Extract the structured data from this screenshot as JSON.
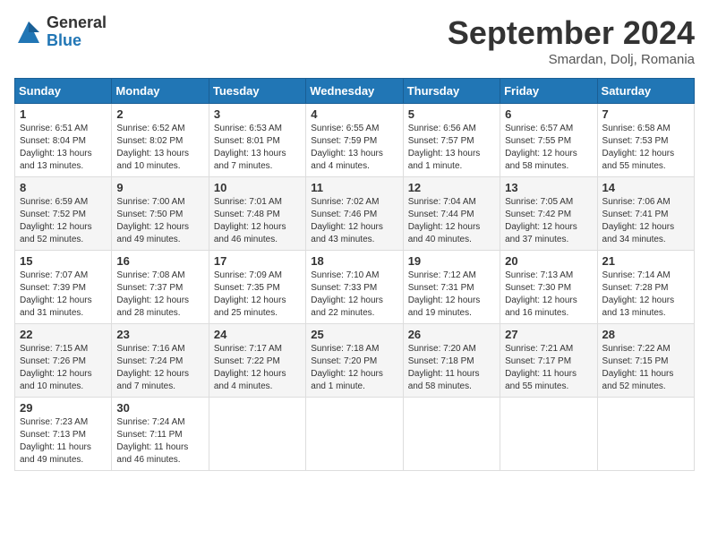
{
  "header": {
    "logo_general": "General",
    "logo_blue": "Blue",
    "month_title": "September 2024",
    "location": "Smardan, Dolj, Romania"
  },
  "weekdays": [
    "Sunday",
    "Monday",
    "Tuesday",
    "Wednesday",
    "Thursday",
    "Friday",
    "Saturday"
  ],
  "weeks": [
    [
      {
        "day": "1",
        "lines": [
          "Sunrise: 6:51 AM",
          "Sunset: 8:04 PM",
          "Daylight: 13 hours",
          "and 13 minutes."
        ]
      },
      {
        "day": "2",
        "lines": [
          "Sunrise: 6:52 AM",
          "Sunset: 8:02 PM",
          "Daylight: 13 hours",
          "and 10 minutes."
        ]
      },
      {
        "day": "3",
        "lines": [
          "Sunrise: 6:53 AM",
          "Sunset: 8:01 PM",
          "Daylight: 13 hours",
          "and 7 minutes."
        ]
      },
      {
        "day": "4",
        "lines": [
          "Sunrise: 6:55 AM",
          "Sunset: 7:59 PM",
          "Daylight: 13 hours",
          "and 4 minutes."
        ]
      },
      {
        "day": "5",
        "lines": [
          "Sunrise: 6:56 AM",
          "Sunset: 7:57 PM",
          "Daylight: 13 hours",
          "and 1 minute."
        ]
      },
      {
        "day": "6",
        "lines": [
          "Sunrise: 6:57 AM",
          "Sunset: 7:55 PM",
          "Daylight: 12 hours",
          "and 58 minutes."
        ]
      },
      {
        "day": "7",
        "lines": [
          "Sunrise: 6:58 AM",
          "Sunset: 7:53 PM",
          "Daylight: 12 hours",
          "and 55 minutes."
        ]
      }
    ],
    [
      {
        "day": "8",
        "lines": [
          "Sunrise: 6:59 AM",
          "Sunset: 7:52 PM",
          "Daylight: 12 hours",
          "and 52 minutes."
        ]
      },
      {
        "day": "9",
        "lines": [
          "Sunrise: 7:00 AM",
          "Sunset: 7:50 PM",
          "Daylight: 12 hours",
          "and 49 minutes."
        ]
      },
      {
        "day": "10",
        "lines": [
          "Sunrise: 7:01 AM",
          "Sunset: 7:48 PM",
          "Daylight: 12 hours",
          "and 46 minutes."
        ]
      },
      {
        "day": "11",
        "lines": [
          "Sunrise: 7:02 AM",
          "Sunset: 7:46 PM",
          "Daylight: 12 hours",
          "and 43 minutes."
        ]
      },
      {
        "day": "12",
        "lines": [
          "Sunrise: 7:04 AM",
          "Sunset: 7:44 PM",
          "Daylight: 12 hours",
          "and 40 minutes."
        ]
      },
      {
        "day": "13",
        "lines": [
          "Sunrise: 7:05 AM",
          "Sunset: 7:42 PM",
          "Daylight: 12 hours",
          "and 37 minutes."
        ]
      },
      {
        "day": "14",
        "lines": [
          "Sunrise: 7:06 AM",
          "Sunset: 7:41 PM",
          "Daylight: 12 hours",
          "and 34 minutes."
        ]
      }
    ],
    [
      {
        "day": "15",
        "lines": [
          "Sunrise: 7:07 AM",
          "Sunset: 7:39 PM",
          "Daylight: 12 hours",
          "and 31 minutes."
        ]
      },
      {
        "day": "16",
        "lines": [
          "Sunrise: 7:08 AM",
          "Sunset: 7:37 PM",
          "Daylight: 12 hours",
          "and 28 minutes."
        ]
      },
      {
        "day": "17",
        "lines": [
          "Sunrise: 7:09 AM",
          "Sunset: 7:35 PM",
          "Daylight: 12 hours",
          "and 25 minutes."
        ]
      },
      {
        "day": "18",
        "lines": [
          "Sunrise: 7:10 AM",
          "Sunset: 7:33 PM",
          "Daylight: 12 hours",
          "and 22 minutes."
        ]
      },
      {
        "day": "19",
        "lines": [
          "Sunrise: 7:12 AM",
          "Sunset: 7:31 PM",
          "Daylight: 12 hours",
          "and 19 minutes."
        ]
      },
      {
        "day": "20",
        "lines": [
          "Sunrise: 7:13 AM",
          "Sunset: 7:30 PM",
          "Daylight: 12 hours",
          "and 16 minutes."
        ]
      },
      {
        "day": "21",
        "lines": [
          "Sunrise: 7:14 AM",
          "Sunset: 7:28 PM",
          "Daylight: 12 hours",
          "and 13 minutes."
        ]
      }
    ],
    [
      {
        "day": "22",
        "lines": [
          "Sunrise: 7:15 AM",
          "Sunset: 7:26 PM",
          "Daylight: 12 hours",
          "and 10 minutes."
        ]
      },
      {
        "day": "23",
        "lines": [
          "Sunrise: 7:16 AM",
          "Sunset: 7:24 PM",
          "Daylight: 12 hours",
          "and 7 minutes."
        ]
      },
      {
        "day": "24",
        "lines": [
          "Sunrise: 7:17 AM",
          "Sunset: 7:22 PM",
          "Daylight: 12 hours",
          "and 4 minutes."
        ]
      },
      {
        "day": "25",
        "lines": [
          "Sunrise: 7:18 AM",
          "Sunset: 7:20 PM",
          "Daylight: 12 hours",
          "and 1 minute."
        ]
      },
      {
        "day": "26",
        "lines": [
          "Sunrise: 7:20 AM",
          "Sunset: 7:18 PM",
          "Daylight: 11 hours",
          "and 58 minutes."
        ]
      },
      {
        "day": "27",
        "lines": [
          "Sunrise: 7:21 AM",
          "Sunset: 7:17 PM",
          "Daylight: 11 hours",
          "and 55 minutes."
        ]
      },
      {
        "day": "28",
        "lines": [
          "Sunrise: 7:22 AM",
          "Sunset: 7:15 PM",
          "Daylight: 11 hours",
          "and 52 minutes."
        ]
      }
    ],
    [
      {
        "day": "29",
        "lines": [
          "Sunrise: 7:23 AM",
          "Sunset: 7:13 PM",
          "Daylight: 11 hours",
          "and 49 minutes."
        ]
      },
      {
        "day": "30",
        "lines": [
          "Sunrise: 7:24 AM",
          "Sunset: 7:11 PM",
          "Daylight: 11 hours",
          "and 46 minutes."
        ]
      },
      null,
      null,
      null,
      null,
      null
    ]
  ]
}
